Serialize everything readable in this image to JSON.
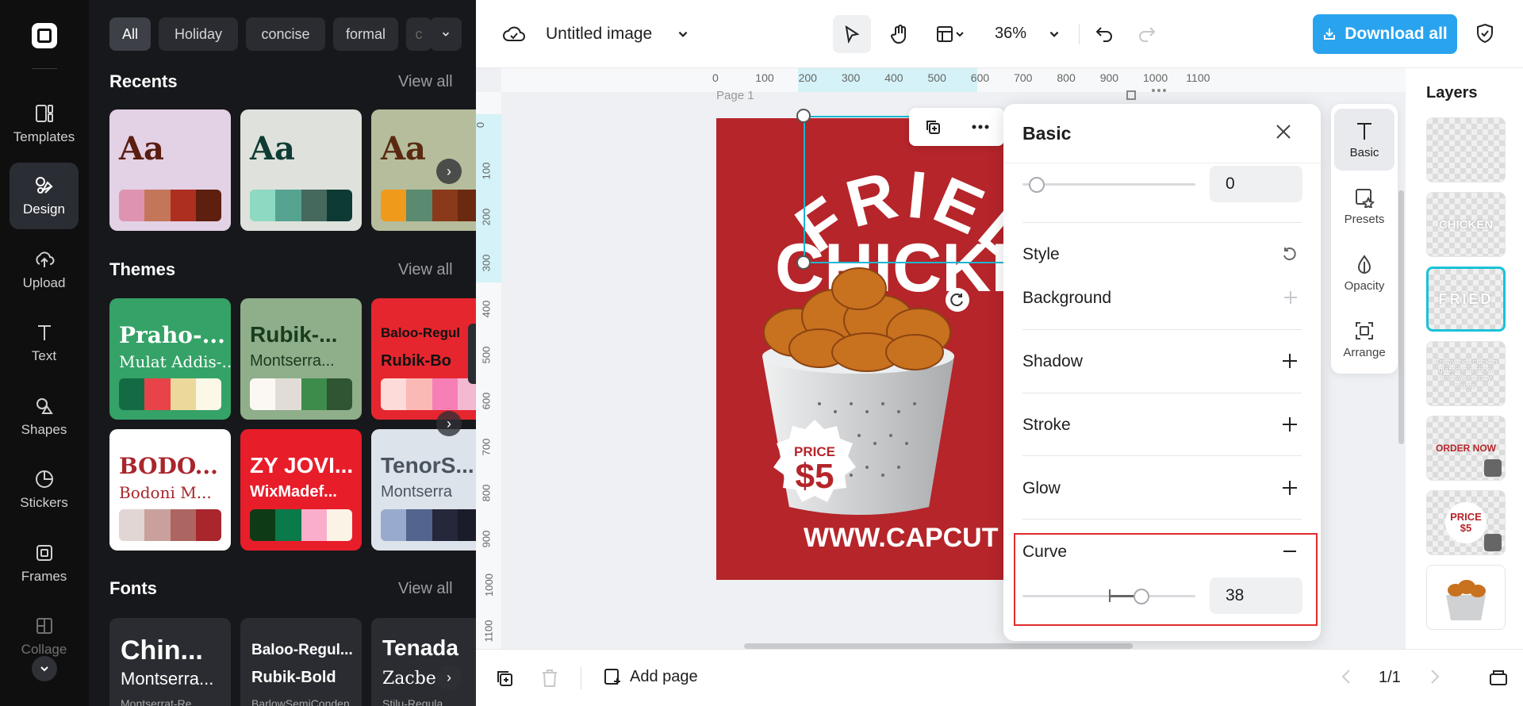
{
  "rail": {
    "items": [
      {
        "label": "Templates",
        "icon": "templates-icon"
      },
      {
        "label": "Design",
        "icon": "design-icon"
      },
      {
        "label": "Upload",
        "icon": "upload-icon"
      },
      {
        "label": "Text",
        "icon": "text-icon"
      },
      {
        "label": "Shapes",
        "icon": "shapes-icon"
      },
      {
        "label": "Stickers",
        "icon": "stickers-icon"
      },
      {
        "label": "Frames",
        "icon": "frames-icon"
      },
      {
        "label": "Collage",
        "icon": "collage-icon"
      }
    ]
  },
  "panel": {
    "chips": [
      "All",
      "Holiday",
      "concise",
      "formal",
      "c"
    ],
    "recents": {
      "title": "Recents",
      "view_all": "View all",
      "cards": [
        {
          "sample": "Aa",
          "bg": "#e3d1e6",
          "text_color": "#5a1d0f",
          "swatches": [
            "#de94b0",
            "#c4765a",
            "#ad2f20",
            "#5e1f0e"
          ]
        },
        {
          "sample": "Aa",
          "bg": "#dfe2dc",
          "text_color": "#0e3b33",
          "swatches": [
            "#8ed9c1",
            "#57a392",
            "#45695d",
            "#0d3a33"
          ]
        },
        {
          "sample": "Aa",
          "bg": "#b5bd9c",
          "text_color": "#5a2a10",
          "swatches": [
            "#f09a1c",
            "#5a8a6f",
            "#8a3a1a",
            "#6b2a10"
          ]
        }
      ]
    },
    "themes": {
      "title": "Themes",
      "view_all": "View all",
      "cards": [
        {
          "title": "Praho-...",
          "subtitle": "Mulat Addis-...",
          "bg": "#35a267",
          "title_color": "#fff",
          "sub_color": "#fff",
          "swatches": [
            "#136b44",
            "#e84348",
            "#ecd89a",
            "#fbf8e8"
          ]
        },
        {
          "title": "Rubik-...",
          "subtitle": "Montserra...",
          "bg": "#8fae8a",
          "title_color": "#173d1c",
          "sub_color": "#173d1c",
          "swatches": [
            "#fbf8f3",
            "#e1ddd6",
            "#3e8c4b",
            "#2f5532"
          ]
        },
        {
          "title": "Baloo-Regul",
          "subtitle": "Rubik-Bo",
          "bg": "#e5262e",
          "title_color": "#111",
          "sub_color": "#111",
          "swatches": [
            "#fddbd9",
            "#fbb9b5",
            "#f67fb6",
            "#f4b8d0"
          ]
        },
        {
          "title": "BODO...",
          "subtitle": "Bodoni M...",
          "bg": "#ffffff",
          "title_color": "#a8262c",
          "sub_color": "#a8262c",
          "swatches": [
            "#e1d6d4",
            "#c9a09c",
            "#ad6561",
            "#a8262c"
          ]
        },
        {
          "title": "ZY JOVI...",
          "subtitle": "WixMadef...",
          "bg": "#e81d2a",
          "title_color": "#fff",
          "sub_color": "#fff",
          "swatches": [
            "#0e3b15",
            "#0a7a4a",
            "#fbadcc",
            "#fbf3e6"
          ]
        },
        {
          "title": "TenorS...",
          "subtitle": "Montserra",
          "bg": "#dde3ea",
          "title_color": "#4a5560",
          "sub_color": "#4a5560",
          "swatches": [
            "#98aacd",
            "#53648f",
            "#25273a",
            "#1a1c2a"
          ]
        }
      ]
    },
    "fonts": {
      "title": "Fonts",
      "view_all": "View all",
      "cards": [
        {
          "l1": "Chin...",
          "l2": "Montserra...",
          "l3": "Montserrat-Re..."
        },
        {
          "l1": "Baloo-Regul...",
          "l2": "Rubik-Bold",
          "l3": "BarlowSemiConden..."
        },
        {
          "l1": "Tenada",
          "l2": "Zacbe",
          "l3": "Stilu-Regula"
        }
      ]
    }
  },
  "topbar": {
    "title": "Untitled image",
    "zoom": "36%",
    "download": "Download all",
    "accent": "#2aa3ef"
  },
  "ruler": {
    "h_ticks": [
      "0",
      "100",
      "200",
      "300",
      "400",
      "500",
      "600",
      "700",
      "800",
      "900",
      "1000",
      "1100"
    ],
    "v_ticks": [
      "0",
      "100",
      "200",
      "300",
      "400",
      "500",
      "600",
      "700",
      "800",
      "900",
      "1000",
      "1100"
    ]
  },
  "canvas": {
    "page_label": "Page 1",
    "poster": {
      "bg": "#b5252a",
      "line1": "FRIED",
      "line2": "CHICKEN",
      "price_label": "PRICE",
      "price": "$5",
      "url": "WWW.CAPCUT"
    }
  },
  "basic_panel": {
    "title": "Basic",
    "top_value": "0",
    "style_label": "Style",
    "background_label": "Background",
    "shadow_label": "Shadow",
    "stroke_label": "Stroke",
    "glow_label": "Glow",
    "curve_label": "Curve",
    "curve_value": "38",
    "curve_level": 0.69,
    "highlight_color": "#e02b2b"
  },
  "strip": {
    "items": [
      {
        "label": "Basic",
        "icon": "text-t-icon"
      },
      {
        "label": "Presets",
        "icon": "presets-icon"
      },
      {
        "label": "Opacity",
        "icon": "opacity-icon"
      },
      {
        "label": "Arrange",
        "icon": "arrange-icon"
      }
    ]
  },
  "layers": {
    "title": "Layers",
    "items": [
      {
        "label": ""
      },
      {
        "label": "CHICKEN"
      },
      {
        "label": "FRIED"
      },
      {
        "label": "Crispy fried chicken glazed in a sticky and sweet spicy sauce"
      },
      {
        "label": "ORDER NOW"
      },
      {
        "label": "PRICE $5"
      },
      {
        "label": ""
      }
    ]
  },
  "bottombar": {
    "add_page": "Add page",
    "pages": "1/1"
  }
}
